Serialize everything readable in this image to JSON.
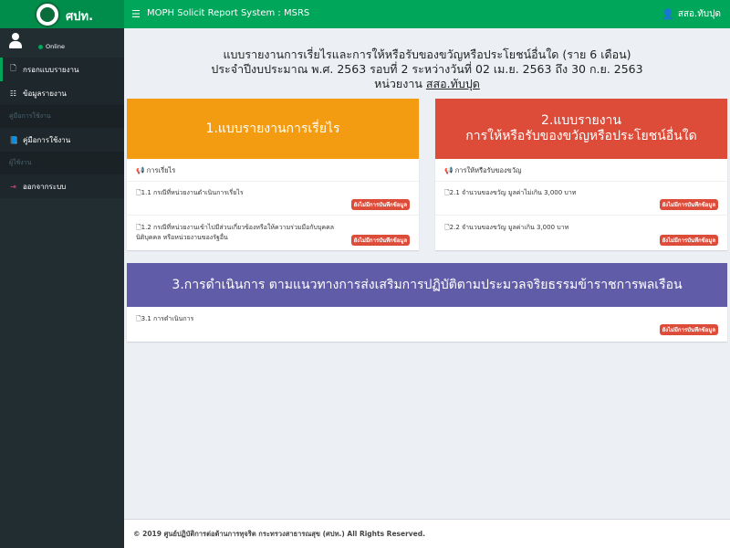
{
  "header": {
    "logo_text": "ศปท.",
    "app_title": "MOPH Solicit Report System : MSRS",
    "user_name": "สสอ.ทับปุด"
  },
  "sidebar": {
    "status": "Online",
    "items": [
      {
        "label": "กรอกแบบรายงาน"
      },
      {
        "label": "ข้อมูลรายงาน"
      },
      {
        "header": "คู่มือการใช้งาน"
      },
      {
        "label": "คู่มือการใช้งาน"
      },
      {
        "header": "ผู้ใช้งาน"
      },
      {
        "label": "ออกจากระบบ"
      }
    ]
  },
  "page": {
    "title_line1": "แบบรายงานการเรี่ยไรและการให้หรือรับของขวัญหรือประโยชน์อื่นใด (ราย 6 เดือน)",
    "title_line2": "ประจำปีงบประมาณ พ.ศ. 2563 รอบที่ 2 ระหว่างวันที่ 02 เม.ย. 2563 ถึง 30 ก.ย. 2563",
    "title_line3_prefix": "หน่วยงาน ",
    "title_line3_unit": "สสอ.ทับปุด"
  },
  "cards": {
    "c1": {
      "title": "1.แบบรายงานการเรี่ยไร",
      "color": "#f39c12",
      "section": "การเรี่ยไร",
      "item1": "1.1 กรณีที่หน่วยงานดำเนินการเรี่ยไร",
      "item2_line1": "1.2 กรณีที่หน่วยงานเข้าไปมีส่วนเกี่ยวข้องหรือให้ความร่วมมือกับบุคคล",
      "item2_line2": "นิติบุคคล หรือหน่วยงานของรัฐอื่น",
      "badge": "ยังไม่มีการบันทึกข้อมูล"
    },
    "c2": {
      "title_line1": "2.แบบรายงาน",
      "title_line2": "การให้หรือรับของขวัญหรือประโยชน์อื่นใด",
      "color": "#dd4b39",
      "section": "การให้หรือรับของขวัญ",
      "item1": "2.1 จำนวนของขวัญ มูลค่าไม่เกิน 3,000 บาท",
      "item2": "2.2 จำนวนของขวัญ มูลค่าเกิน 3,000 บาท",
      "badge": "ยังไม่มีการบันทึกข้อมูล"
    },
    "c3": {
      "title": "3.การดำเนินการ ตามแนวทางการส่งเสริมการปฏิบัติตามประมวลจริยธรรมข้าราชการพลเรือน",
      "color": "#605ca8",
      "item1": "3.1 การดำเนินการ",
      "badge": "ยังไม่มีการบันทึกข้อมูล"
    }
  },
  "footer": {
    "text": "© 2019 ศูนย์ปฏิบัติการต่อต้านการทุจริต กระทรวงสาธารณสุข (ศปท.) All Rights Reserved."
  }
}
